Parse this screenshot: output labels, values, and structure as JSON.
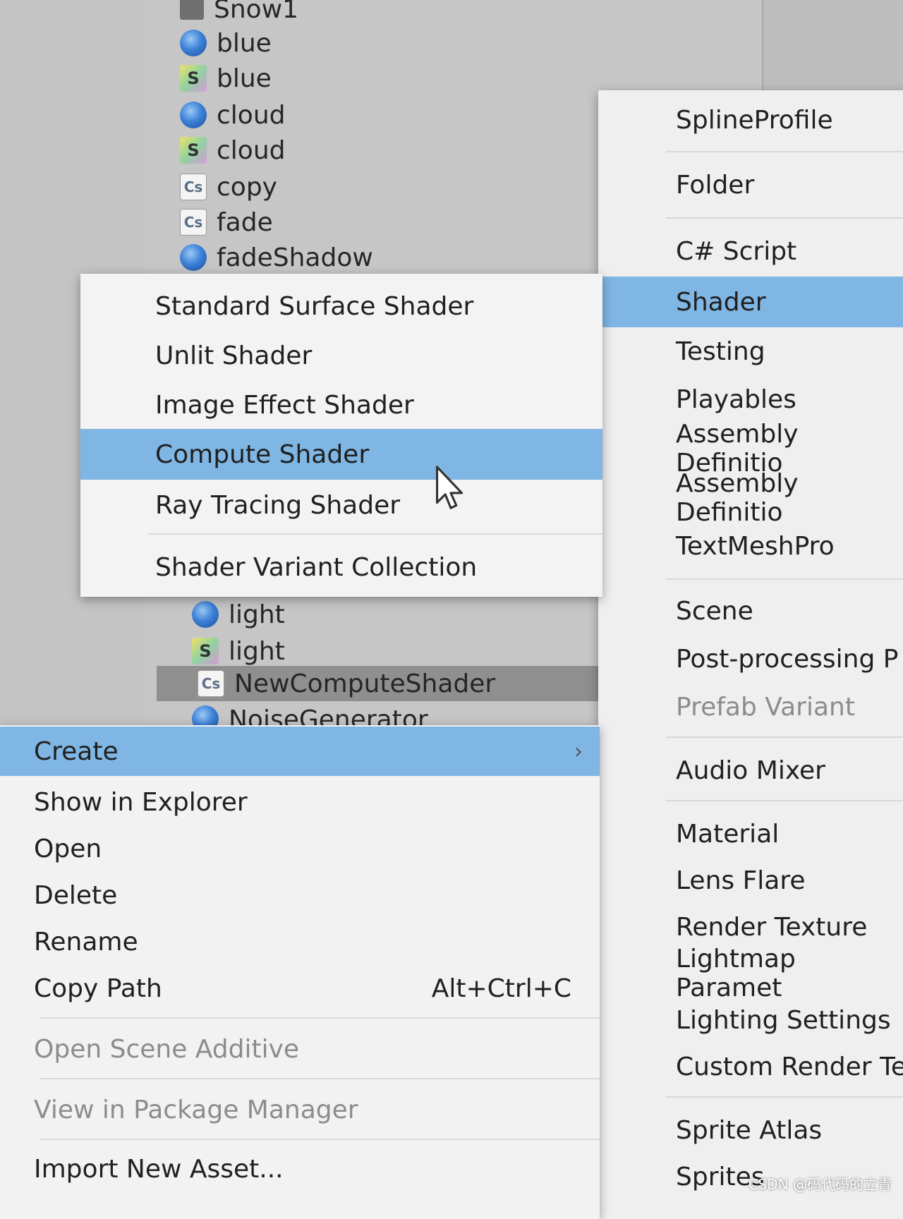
{
  "project_assets": [
    {
      "icon": "snow-icon",
      "label": "Snow1"
    },
    {
      "icon": "material-sphere-icon",
      "label": "blue"
    },
    {
      "icon": "shader-file-icon",
      "label": "blue"
    },
    {
      "icon": "material-sphere-icon",
      "label": "cloud"
    },
    {
      "icon": "shader-file-icon",
      "label": "cloud"
    },
    {
      "icon": "csharp-file-icon",
      "label": "copy"
    },
    {
      "icon": "csharp-file-icon",
      "label": "fade"
    },
    {
      "icon": "material-sphere-icon",
      "label": "fadeShadow"
    },
    {
      "icon": "material-sphere-icon",
      "label": "light"
    },
    {
      "icon": "shader-file-icon",
      "label": "light"
    },
    {
      "icon": "csharp-file-icon",
      "label": "NewComputeShader"
    },
    {
      "icon": "material-sphere-icon",
      "label": "NoiseGenerator"
    }
  ],
  "icon_glyphs": {
    "shader": "S",
    "csharp": "Cs"
  },
  "context_menu": {
    "items": [
      {
        "label": "Create",
        "highlighted": true
      },
      {
        "label": "Show in Explorer"
      },
      {
        "label": "Open"
      },
      {
        "label": "Delete"
      },
      {
        "label": "Rename"
      },
      {
        "label": "Copy Path",
        "shortcut": "Alt+Ctrl+C"
      },
      {
        "label": "Open Scene Additive",
        "disabled": true
      },
      {
        "label": "View in Package Manager",
        "disabled": true
      },
      {
        "label": "Import New Asset..."
      }
    ],
    "submenu_arrow": "›"
  },
  "create_submenu": {
    "items": [
      "SplineProfile",
      "Folder",
      "C# Script",
      "Shader",
      "Testing",
      "Playables",
      "Assembly Definitio",
      "Assembly Definitio",
      "TextMeshPro",
      "Scene",
      "Post-processing P",
      "Prefab Variant",
      "Audio Mixer",
      "Material",
      "Lens Flare",
      "Render Texture",
      "Lightmap Paramet",
      "Lighting Settings",
      "Custom Render Te",
      "Sprite Atlas",
      "Sprites"
    ],
    "highlighted": "Shader",
    "disabled": [
      "Prefab Variant"
    ]
  },
  "shader_submenu": {
    "items": [
      "Standard Surface Shader",
      "Unlit Shader",
      "Image Effect Shader",
      "Compute Shader",
      "Ray Tracing Shader",
      "Shader Variant Collection"
    ],
    "highlighted": "Compute Shader"
  },
  "watermark": "CSDN @码代码的立青",
  "colors": {
    "highlight": "#7fb6e3",
    "menu_bg": "#f2f2f2",
    "selected_row": "#8f8f8f"
  }
}
